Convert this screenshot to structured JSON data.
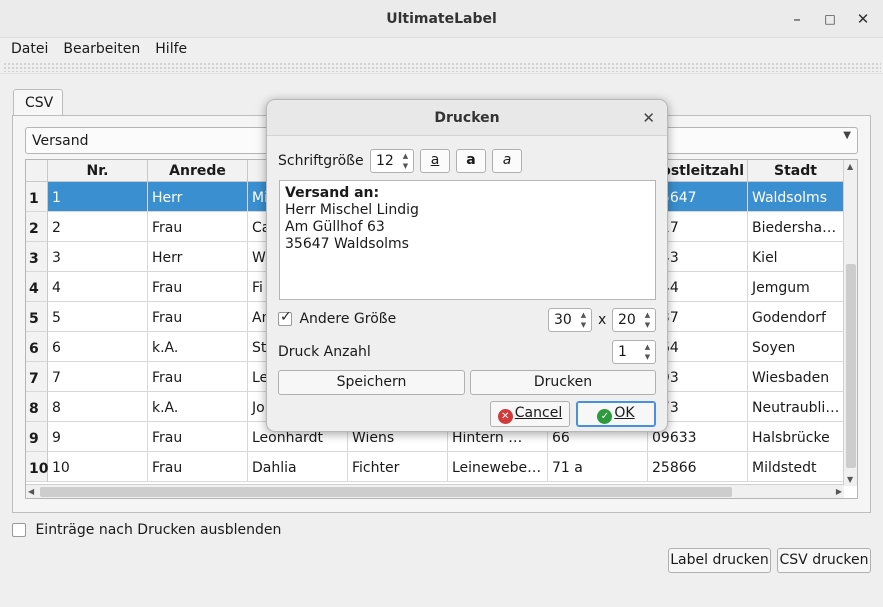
{
  "window": {
    "title": "UltimateLabel",
    "minimize_icon": "minimize-icon",
    "maximize_icon": "maximize-icon",
    "close_icon": "close-icon"
  },
  "menu": {
    "file": "Datei",
    "edit": "Bearbeiten",
    "help": "Hilfe"
  },
  "tabs": [
    {
      "label": "CSV"
    }
  ],
  "combo": {
    "value": "Versand"
  },
  "table": {
    "headers": [
      "Nr.",
      "Anrede",
      "",
      "",
      "",
      "",
      "Postleitzahl",
      "Stadt"
    ],
    "rows": [
      {
        "rh": "1",
        "cells": [
          "1",
          "Herr",
          "Mi",
          "",
          "",
          "",
          "35647",
          "Waldsolms"
        ]
      },
      {
        "rh": "2",
        "cells": [
          "2",
          "Frau",
          "Ca",
          "",
          "",
          "",
          "917",
          "Biedershau…"
        ]
      },
      {
        "rh": "3",
        "cells": [
          "3",
          "Herr",
          "Wi",
          "",
          "",
          "",
          "143",
          "Kiel"
        ]
      },
      {
        "rh": "4",
        "cells": [
          "4",
          "Frau",
          "Fi",
          "",
          "",
          "",
          "844",
          "Jemgum"
        ]
      },
      {
        "rh": "5",
        "cells": [
          "5",
          "Frau",
          "An",
          "",
          "",
          "",
          "237",
          "Godendorf"
        ]
      },
      {
        "rh": "6",
        "cells": [
          "6",
          "k.A.",
          "St",
          "",
          "",
          "",
          "564",
          "Soyen"
        ]
      },
      {
        "rh": "7",
        "cells": [
          "7",
          "Frau",
          "Le",
          "",
          "",
          "",
          "193",
          "Wiesbaden"
        ]
      },
      {
        "rh": "8",
        "cells": [
          "8",
          "k.A.",
          "Jo",
          "",
          "",
          "",
          "073",
          "Neutraubling"
        ]
      },
      {
        "rh": "9",
        "cells": [
          "9",
          "Frau",
          "Leonhardt",
          "Wiens",
          "Hintern …",
          "66",
          "09633",
          "Halsbrücke"
        ]
      },
      {
        "rh": "10",
        "cells": [
          "10",
          "Frau",
          "Dahlia",
          "Fichter",
          "Leinewebe…",
          "71 a",
          "25866",
          "Mildstedt"
        ]
      }
    ]
  },
  "footer": {
    "hide_after_print_label": "Einträge nach Drucken ausblenden",
    "label_print_button": "Label drucken",
    "csv_print_button": "CSV drucken"
  },
  "dialog": {
    "title": "Drucken",
    "font_size_label": "Schriftgröße",
    "font_size_value": "12",
    "style_buttons": [
      "a",
      "a",
      "a"
    ],
    "label_text": {
      "heading": "Versand an:",
      "line1": "Herr Mischel Lindig",
      "line2": "Am Güllhof 63",
      "line3": "35647 Waldsolms"
    },
    "other_size_label": "Andere Größe",
    "other_size_checked": true,
    "width_value": "30",
    "times_label": "x",
    "height_value": "20",
    "print_count_label": "Druck Anzahl",
    "print_count_value": "1",
    "save_button": "Speichern",
    "print_button": "Drucken",
    "cancel_button": "Cancel",
    "ok_button": "OK",
    "cancel_icon": "cancel-icon",
    "ok_icon": "ok-icon"
  }
}
